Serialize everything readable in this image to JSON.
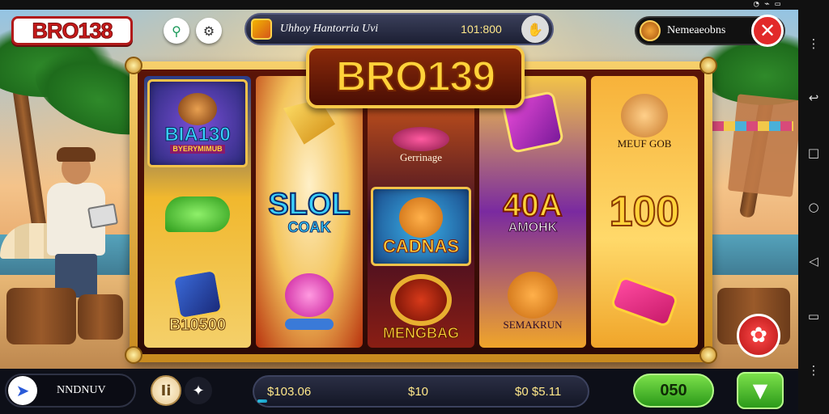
{
  "header": {
    "logo_text": "BRO138",
    "ticker_title": "Uhhoy Hantorria Uvi",
    "ticker_value": "101:800",
    "username": "Nemeaeobns"
  },
  "game": {
    "title": "BRO139",
    "symbols": {
      "r1c1_label": "BIA130",
      "r1c1_sub": "BYERYMIMUB",
      "r1c3_label": "B10500",
      "r2c2_label_top": "SLOL",
      "r2c2_label_bottom": "COAK",
      "r3c1_label": "Gerrinage",
      "r3c2_label": "CADNAS",
      "r3c3_label": "MENGBAG",
      "r4c2_label_top": "40A",
      "r4c2_label_bottom": "AMOHK",
      "r4c3_label": "SEMAKRUN",
      "r5c1_label": "MEUF GOB",
      "r5c2_label": "100"
    }
  },
  "bottom": {
    "left_label": "NNDNUV",
    "coin_label": "Ii",
    "bet_left": "$103.06",
    "bet_mid": "$10",
    "bet_right": "$0 $5.11",
    "bet_progress": 0.03,
    "win_value": "050"
  },
  "colors": {
    "accent_gold": "#f7c948",
    "accent_red": "#e22a2a",
    "accent_green": "#4fc22a"
  },
  "icons": {
    "search": "search-icon",
    "settings": "settings-icon",
    "close": "close-icon",
    "hand": "hand-icon",
    "flower": "flower-icon",
    "chevron_down": "chevron-down-icon",
    "compass": "compass-icon",
    "star": "star-icon"
  }
}
